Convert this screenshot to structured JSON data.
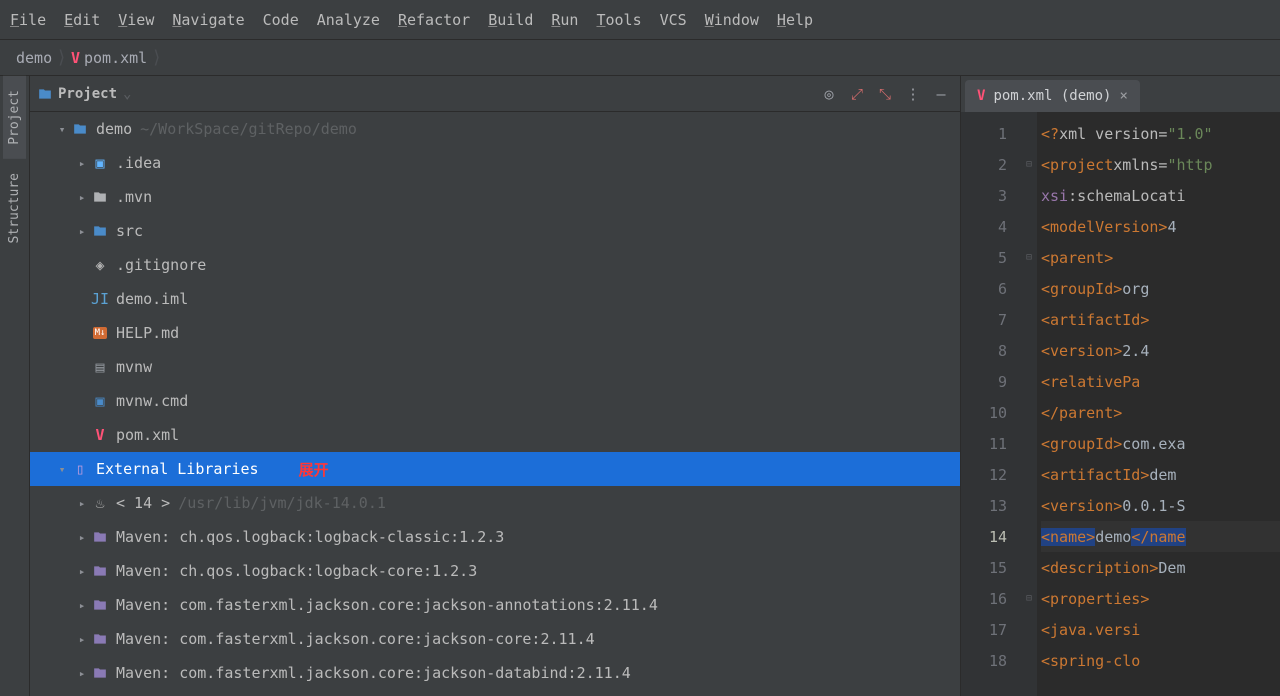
{
  "menu": [
    "File",
    "Edit",
    "View",
    "Navigate",
    "Code",
    "Analyze",
    "Refactor",
    "Build",
    "Run",
    "Tools",
    "VCS",
    "Window",
    "Help"
  ],
  "menuUnderline": [
    0,
    0,
    0,
    0,
    -1,
    -1,
    0,
    0,
    0,
    0,
    -1,
    0,
    0
  ],
  "breadcrumb": {
    "root": "demo",
    "file": "pom.xml"
  },
  "leftbar": {
    "project": "Project",
    "structure": "Structure"
  },
  "projectHeader": {
    "title": "Project"
  },
  "tree": [
    {
      "depth": 0,
      "arrow": "down",
      "iconType": "folder-blue",
      "label": "demo",
      "path": "~/WorkSpace/gitRepo/demo",
      "selected": false
    },
    {
      "depth": 1,
      "arrow": "right",
      "iconType": "idea",
      "label": ".idea",
      "selected": false
    },
    {
      "depth": 1,
      "arrow": "right",
      "iconType": "folder-plain",
      "label": ".mvn",
      "selected": false
    },
    {
      "depth": 1,
      "arrow": "right",
      "iconType": "folder-blue",
      "label": "src",
      "selected": false
    },
    {
      "depth": 1,
      "arrow": "none",
      "iconType": "git",
      "label": ".gitignore",
      "selected": false
    },
    {
      "depth": 1,
      "arrow": "none",
      "iconType": "iml",
      "label": "demo.iml",
      "selected": false
    },
    {
      "depth": 1,
      "arrow": "none",
      "iconType": "md",
      "label": "HELP.md",
      "selected": false
    },
    {
      "depth": 1,
      "arrow": "none",
      "iconType": "file",
      "label": "mvnw",
      "selected": false
    },
    {
      "depth": 1,
      "arrow": "none",
      "iconType": "cmd",
      "label": "mvnw.cmd",
      "selected": false
    },
    {
      "depth": 1,
      "arrow": "none",
      "iconType": "pom",
      "label": "pom.xml",
      "selected": false
    },
    {
      "depth": 0,
      "arrow": "down",
      "iconType": "lib",
      "label": "External Libraries",
      "selected": true,
      "anno": "展开"
    },
    {
      "depth": 1,
      "arrow": "right",
      "iconType": "java",
      "label": "< 14 >",
      "path": "/usr/lib/jvm/jdk-14.0.1",
      "selected": false
    },
    {
      "depth": 1,
      "arrow": "right",
      "iconType": "mvn",
      "label": "Maven: ch.qos.logback:logback-classic:1.2.3",
      "selected": false
    },
    {
      "depth": 1,
      "arrow": "right",
      "iconType": "mvn",
      "label": "Maven: ch.qos.logback:logback-core:1.2.3",
      "selected": false
    },
    {
      "depth": 1,
      "arrow": "right",
      "iconType": "mvn",
      "label": "Maven: com.fasterxml.jackson.core:jackson-annotations:2.11.4",
      "selected": false
    },
    {
      "depth": 1,
      "arrow": "right",
      "iconType": "mvn",
      "label": "Maven: com.fasterxml.jackson.core:jackson-core:2.11.4",
      "selected": false
    },
    {
      "depth": 1,
      "arrow": "right",
      "iconType": "mvn",
      "label": "Maven: com.fasterxml.jackson.core:jackson-databind:2.11.4",
      "selected": false
    }
  ],
  "editor": {
    "tab": "pom.xml (demo)",
    "lines": [
      {
        "n": 1,
        "html": "<span class='tag'>&lt;?</span><span class='attr'>xml version=</span><span class='str'>\"1.0\"</span>"
      },
      {
        "n": 2,
        "html": "<span class='tag'>&lt;project</span> <span class='attr'>xmlns=</span><span class='str'>\"http</span>",
        "fold": "-"
      },
      {
        "n": 3,
        "html": "         <span class='kw'>xsi</span><span class='attr'>:schemaLocati</span>"
      },
      {
        "n": 4,
        "html": "    <span class='tag'>&lt;modelVersion&gt;</span><span>4</span>"
      },
      {
        "n": 5,
        "html": "    <span class='tag'>&lt;parent&gt;</span>",
        "fold": "-"
      },
      {
        "n": 6,
        "html": "        <span class='tag'>&lt;groupId&gt;</span>org"
      },
      {
        "n": 7,
        "html": "        <span class='tag'>&lt;artifactId&gt;</span>"
      },
      {
        "n": 8,
        "html": "        <span class='tag'>&lt;version&gt;</span>2.4"
      },
      {
        "n": 9,
        "html": "        <span class='tag'>&lt;relativePa</span>"
      },
      {
        "n": 10,
        "html": "    <span class='tag'>&lt;/parent&gt;</span>"
      },
      {
        "n": 11,
        "html": "    <span class='tag'>&lt;groupId&gt;</span>com.exa"
      },
      {
        "n": 12,
        "html": "    <span class='tag'>&lt;artifactId&gt;</span>dem"
      },
      {
        "n": 13,
        "html": "    <span class='tag'>&lt;version&gt;</span>0.0.1-S"
      },
      {
        "n": 14,
        "html": "    <span class='hl tag'>&lt;name&gt;</span>demo<span class='hl tag'>&lt;/name</span>",
        "current": true
      },
      {
        "n": 15,
        "html": "    <span class='tag'>&lt;description&gt;</span>Dem"
      },
      {
        "n": 16,
        "html": "    <span class='tag'>&lt;properties&gt;</span>",
        "fold": "-"
      },
      {
        "n": 17,
        "html": "        <span class='tag'>&lt;java.versi</span>"
      },
      {
        "n": 18,
        "html": "        <span class='tag'>&lt;spring-clo</span>"
      }
    ]
  }
}
